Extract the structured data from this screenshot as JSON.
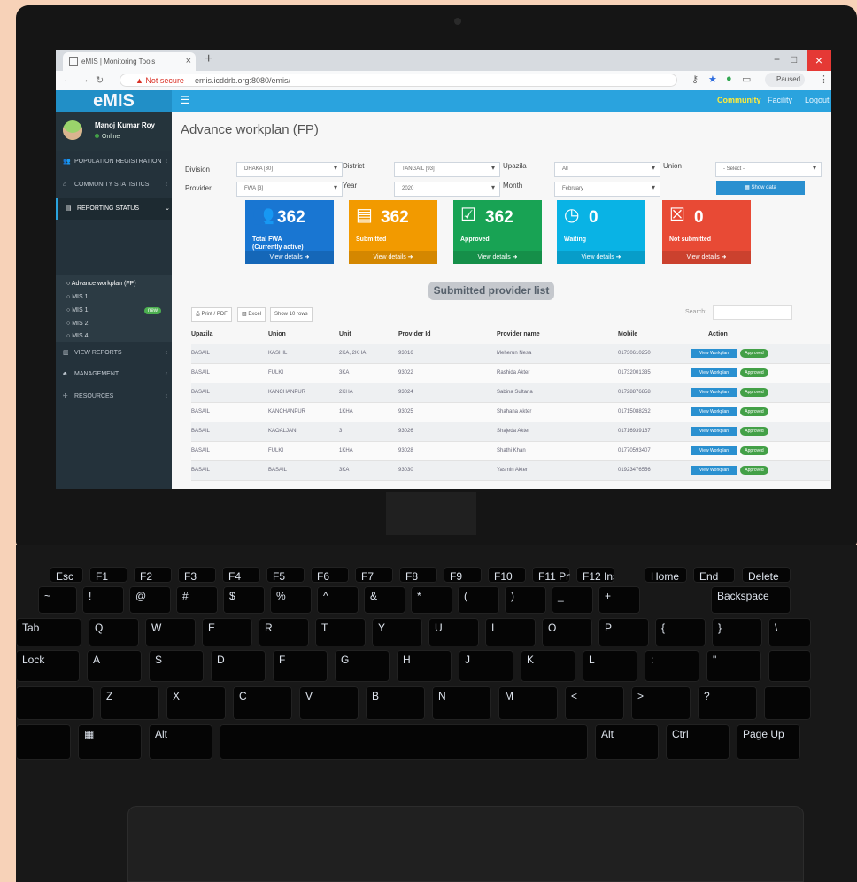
{
  "browser": {
    "tab_title": "eMIS | Monitoring Tools",
    "not_secure": "Not secure",
    "url": "emis.icddrb.org:8080/emis/",
    "paused": "Paused"
  },
  "app": {
    "brand": "eMIS",
    "top_menu": [
      "Community",
      "Facility",
      "Logout"
    ],
    "profile_name": "Manoj Kumar Roy",
    "online": "Online",
    "sidebar": [
      "POPULATION REGISTRATION",
      "COMMUNITY STATISTICS",
      "REPORTING STATUS",
      "VIEW REPORTS",
      "MANAGEMENT",
      "RESOURCES"
    ],
    "submenu": [
      "Advance workplan (FP)",
      "MIS 1",
      "MIS 1",
      "MIS 2",
      "MIS 4"
    ],
    "new_badge": "new",
    "page_title": "Advance workplan (FP)"
  },
  "filters": {
    "division_label": "Division",
    "division_value": "DHAKA [30]",
    "district_label": "District",
    "district_value": "TANGAIL [93]",
    "upazila_label": "Upazila",
    "upazila_value": "All",
    "union_label": "Union",
    "union_value": "- Select -",
    "provider_label": "Provider",
    "provider_value": "FWA [3]",
    "year_label": "Year",
    "year_value": "2020",
    "month_label": "Month",
    "month_value": "February",
    "show_data": "Show data"
  },
  "cards": [
    {
      "value": "362",
      "label": "Total FWA",
      "sub": "(Currently active)",
      "link": "View details",
      "color": "#1976d2"
    },
    {
      "value": "362",
      "label": "Submitted",
      "sub": "",
      "link": "View details",
      "color": "#f29a00"
    },
    {
      "value": "362",
      "label": "Approved",
      "sub": "",
      "link": "View details",
      "color": "#18a354"
    },
    {
      "value": "0",
      "label": "Waiting",
      "sub": "",
      "link": "View details",
      "color": "#09b3e5"
    },
    {
      "value": "0",
      "label": "Not submitted",
      "sub": "",
      "link": "View details",
      "color": "#e84a35"
    }
  ],
  "list": {
    "title": "Submitted provider list",
    "print": "Print / PDF",
    "excel": "Excel",
    "rows_label": "Show 10 rows",
    "search": "Search:",
    "headers": [
      "Upazila",
      "Union",
      "Unit",
      "Provider Id",
      "Provider name",
      "Mobile",
      "Action"
    ],
    "rows": [
      [
        "BASAIL",
        "KASHIL",
        "2KA, 2KHA",
        "93016",
        "Meherun Nesa",
        "01730610250"
      ],
      [
        "BASAIL",
        "FULKI",
        "3KA",
        "93022",
        "Rashida Akter",
        "01732001335"
      ],
      [
        "BASAIL",
        "KANCHANPUR",
        "2KHA",
        "93024",
        "Sabina Sultana",
        "01728876858"
      ],
      [
        "BASAIL",
        "KANCHANPUR",
        "1KHA",
        "93025",
        "Shahana Akter",
        "01715088262"
      ],
      [
        "BASAIL",
        "KAOALJANI",
        "3",
        "93026",
        "Shajeda Akter",
        "01716939167"
      ],
      [
        "BASAIL",
        "FULKI",
        "1KHA",
        "93028",
        "Shathi Khan",
        "01770593407"
      ],
      [
        "BASAIL",
        "BASAIL",
        "3KA",
        "93030",
        "Yasmin Akter",
        "01923476556"
      ]
    ],
    "view_workplan": "View Workplan",
    "approved": "Approved"
  },
  "keyboard": {
    "function_row": [
      "Esc",
      "F1",
      "F2",
      "F3",
      "F4",
      "F5",
      "F6",
      "F7",
      "F8",
      "F9",
      "F10",
      "F11 PrtScr",
      "F12 Insert",
      "Home",
      "End",
      "Delete"
    ],
    "number_row": [
      "~",
      "!",
      "@",
      "#",
      "$",
      "%",
      "^",
      "&",
      "*",
      "(",
      ")",
      "_",
      "+",
      "Backspace"
    ],
    "top_row": [
      "Tab",
      "Q",
      "W",
      "E",
      "R",
      "T",
      "Y",
      "U",
      "I",
      "O",
      "P",
      "{",
      "}",
      "\\"
    ],
    "home_row": [
      "Lock",
      "A",
      "S",
      "D",
      "F",
      "G",
      "H",
      "J",
      "K",
      "L",
      ":",
      "\"",
      ""
    ],
    "bottom_row": [
      "",
      "Z",
      "X",
      "C",
      "V",
      "B",
      "N",
      "M",
      "<",
      ">",
      "?",
      ""
    ],
    "control_row": [
      "",
      "",
      "Alt",
      "",
      "Alt",
      "Ctrl",
      "Page Up"
    ]
  }
}
